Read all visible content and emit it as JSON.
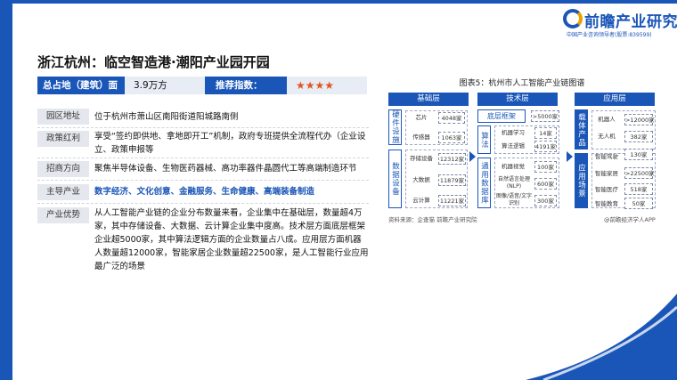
{
  "logo": {
    "name": "前瞻产业研究院",
    "subtitle": "中国产业咨询领导者(股票:839599)"
  },
  "title": "浙江杭州：临空智造港·潮阳产业园开园",
  "summary": {
    "area_label": "总占地（建筑）面积：",
    "area_value": "3.9万方",
    "rating_label": "推荐指数：",
    "rating_stars": "★★★★",
    "rating_value": 4
  },
  "rows": [
    {
      "label": "园区地址",
      "text": "位于杭州市萧山区南阳街道阳城路南侧"
    },
    {
      "label": "政策红利",
      "text": "享受“签约即供地、拿地即开工”机制，政府专班提供全流程代办（企业设立、政策申报等"
    },
    {
      "label": "招商方向",
      "text": "聚焦半导体设备、生物医药器械、高功率器件晶圆代工等高端制造环节"
    },
    {
      "label": "主导产业",
      "text": "数字经济、文化创意、金融服务、生命健康、高端装备制造"
    },
    {
      "label": "产业优势",
      "text": "从人工智能产业链的企业分布数量来看，企业集中在基础层，数量超4万家，其中存储设备、大数据、云计算企业集中度高。技术层方面底层框架企业超5000家，其中算法逻辑方面的企业数量占八成。应用层方面机器人数量超12000家，智能家居企业数量超22500家，是人工智能行业应用最广泛的场景"
    }
  ],
  "diagram": {
    "title": "图表5：杭州市人工智能产业链图谱",
    "columns": [
      "基础层",
      "技术层",
      "应用层"
    ],
    "basic": {
      "hardware_label": "硬件设施",
      "data_label": "数据设备",
      "items": [
        {
          "name": "芯片",
          "value": "4048家"
        },
        {
          "name": "传感器",
          "value": "1063家"
        },
        {
          "name": "存储设备",
          "value": "12312家"
        },
        {
          "name": "大数据",
          "value": "11879家"
        },
        {
          "name": "云计算",
          "value": "11221家"
        }
      ]
    },
    "tech": {
      "framework_label": "底层框架",
      "framework_value": ">5000家",
      "algorithm_label": "算法",
      "database_label": "通用数据库",
      "items": [
        {
          "name": "机器学习",
          "value": "14家"
        },
        {
          "name": "算法逻辑",
          "value": "4191家"
        },
        {
          "name": "机器视觉",
          "value": "100家"
        },
        {
          "name": "自然语言处理(NLP)",
          "value": "600家"
        },
        {
          "name": "图像/语音/文字识别",
          "value": "300家"
        }
      ]
    },
    "app": {
      "product_label": "载体产品",
      "scene_label": "应用场景",
      "items": [
        {
          "name": "机器人",
          "value": ">12000家"
        },
        {
          "name": "无人机",
          "value": "382家"
        },
        {
          "name": "智能驾驶",
          "value": "130家"
        },
        {
          "name": "智能家居",
          "value": ">22500家"
        },
        {
          "name": "智能医疗",
          "value": "518家"
        },
        {
          "name": "智能教育",
          "value": "50家"
        }
      ]
    },
    "source_left": "资料来源：企查猫 前瞻产业研究院",
    "source_right": "@前瞻经济学人APP"
  },
  "colors": {
    "primary": "#1a56b8",
    "star": "#e0561f",
    "accent_text": "#1a56b8"
  }
}
